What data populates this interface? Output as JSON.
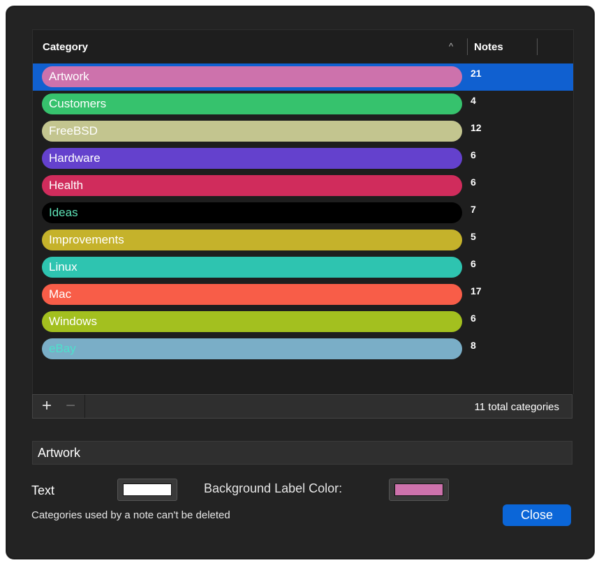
{
  "table": {
    "header": {
      "category": "Category",
      "notes": "Notes",
      "sort_icon": "chevron-up-icon"
    },
    "rows": [
      {
        "name": "Artwork",
        "count": "21",
        "bg": "#cd72ac",
        "fg": "#ffffff",
        "selected": true
      },
      {
        "name": "Customers",
        "count": "4",
        "bg": "#36c26d",
        "fg": "#ffffff",
        "selected": false
      },
      {
        "name": "FreeBSD",
        "count": "12",
        "bg": "#c3c58f",
        "fg": "#ffffff",
        "selected": false
      },
      {
        "name": "Hardware",
        "count": "6",
        "bg": "#6441cd",
        "fg": "#ffffff",
        "selected": false
      },
      {
        "name": "Health",
        "count": "6",
        "bg": "#d02c5c",
        "fg": "#ffffff",
        "selected": false
      },
      {
        "name": "Ideas",
        "count": "7",
        "bg": "#000000",
        "fg": "#5ee3b7",
        "selected": false
      },
      {
        "name": "Improvements",
        "count": "5",
        "bg": "#c5b22b",
        "fg": "#ffffff",
        "selected": false
      },
      {
        "name": "Linux",
        "count": "6",
        "bg": "#2ec4b0",
        "fg": "#ffffff",
        "selected": false
      },
      {
        "name": "Mac",
        "count": "17",
        "bg": "#f85d48",
        "fg": "#ffffff",
        "selected": false
      },
      {
        "name": "Windows",
        "count": "6",
        "bg": "#a3c01f",
        "fg": "#ffffff",
        "selected": false
      },
      {
        "name": "eBay",
        "count": "8",
        "bg": "#7aaec7",
        "fg": "#4de1cc",
        "selected": false
      }
    ],
    "selection_color": "#1060d0"
  },
  "bottom_bar": {
    "add_label": "+",
    "remove_label": "−",
    "total": "11 total categories"
  },
  "editor": {
    "name_value": "Artwork",
    "text_label": "Text",
    "text_color": "#ffffff",
    "bg_label": "Background Label Color:",
    "bg_color": "#cd72ac",
    "note": "Categories used by a note can't be deleted",
    "close_label": "Close"
  }
}
